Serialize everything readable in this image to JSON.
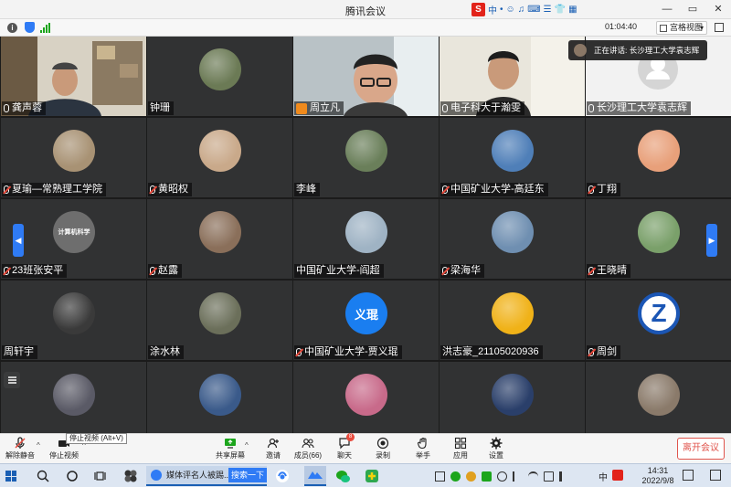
{
  "window": {
    "title": "腾讯会议",
    "controls": [
      "—",
      "▭",
      "✕"
    ]
  },
  "ime": {
    "logo": "S",
    "chars": [
      "中",
      "•",
      "☺",
      "♫",
      "⌨",
      "☰",
      "👕",
      "▦"
    ]
  },
  "infobar": {
    "timer": "01:04:40",
    "view_mode": "宫格视图"
  },
  "speaker": {
    "text": "正在讲话: 长沙理工大学袁志辉"
  },
  "tiles": [
    {
      "name": "龚声蓉",
      "mic": "on",
      "video": "office",
      "highlight": false
    },
    {
      "name": "钟珊",
      "mic": "none",
      "video": "none",
      "avatar": "#6b7a55",
      "highlight": false
    },
    {
      "name": "周立凡",
      "mic": "host",
      "video": "man1",
      "highlight": false
    },
    {
      "name": "电子科大于瀚雯",
      "mic": "on",
      "video": "man2",
      "highlight": false
    },
    {
      "name": "长沙理工大学袁志辉",
      "mic": "on",
      "video": "default",
      "highlight": true
    },
    {
      "name": "夏瑜—常熟理工学院",
      "mic": "muted",
      "avatar": "#a89274"
    },
    {
      "name": "黄昭权",
      "mic": "muted",
      "avatar": "#c9a98a"
    },
    {
      "name": "李峰",
      "mic": "none",
      "avatar": "#6a7f5a"
    },
    {
      "name": "中国矿业大学-高廷东",
      "mic": "muted",
      "avatar": "#4f7fb8"
    },
    {
      "name": "丁翔",
      "mic": "muted",
      "avatar": "#e8a07a"
    },
    {
      "name": "23班张安平",
      "mic": "muted",
      "avatar": "#6e6e6e",
      "avatar_text": "计算机科学"
    },
    {
      "name": "赵露",
      "mic": "muted",
      "avatar": "#8a6f5a"
    },
    {
      "name": "中国矿业大学-阎超",
      "mic": "none",
      "avatar": "#9fb3c4"
    },
    {
      "name": "梁海华",
      "mic": "muted",
      "avatar": "#6f8fb1"
    },
    {
      "name": "王晓晴",
      "mic": "muted",
      "avatar": "#7aa06a"
    },
    {
      "name": "周轩宇",
      "mic": "none",
      "avatar": "#3a3a3a"
    },
    {
      "name": "涂水林",
      "mic": "none",
      "avatar": "#6b6f5a"
    },
    {
      "name": "中国矿业大学-贾义琨",
      "mic": "muted",
      "avatar": "#1a7ef0",
      "avatar_text": "义琨"
    },
    {
      "name": "洪志豪_21105020936",
      "mic": "none",
      "avatar": "#f0b218"
    },
    {
      "name": "周剑",
      "mic": "muted",
      "avatar": "#1b56b5",
      "avatar_text": "Z"
    },
    {
      "name": "",
      "mic": "none",
      "avatar": "#5a5a66"
    },
    {
      "name": "",
      "mic": "none",
      "avatar": "#3a5a8a"
    },
    {
      "name": "",
      "mic": "none",
      "avatar": "#c86a8a"
    },
    {
      "name": "",
      "mic": "none",
      "avatar": "#2a3f6a"
    },
    {
      "name": "",
      "mic": "none",
      "avatar": "#8a7a6a"
    }
  ],
  "tooltip": "停止视频 (Alt+V)",
  "toolbar": {
    "unmute": "解除静音",
    "stop_video": "停止视频",
    "share": "共享屏幕",
    "invite": "邀请",
    "members": "成员(66)",
    "chat": "聊天",
    "chat_badge": "8",
    "record": "录制",
    "raise_hand": "举手",
    "apps": "应用",
    "settings": "设置",
    "leave": "离开会议"
  },
  "taskbar": {
    "window_title": "媒体评名人被踢...",
    "search_button": "搜索一下",
    "ime": "中",
    "time": "14:31",
    "date": "2022/9/8"
  }
}
